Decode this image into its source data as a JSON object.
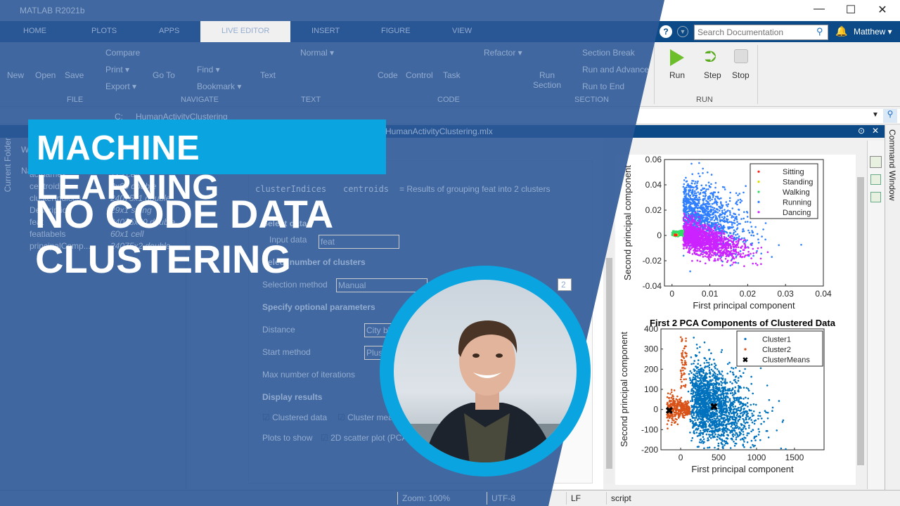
{
  "window": {
    "title": "MATLAB R2021b",
    "minimize": "—",
    "maximize": "☐",
    "close": "✕"
  },
  "tabs": [
    "HOME",
    "PLOTS",
    "APPS",
    "LIVE EDITOR",
    "INSERT",
    "FIGURE",
    "VIEW"
  ],
  "search": {
    "placeholder": "Search Documentation"
  },
  "user": "Matthew ▾",
  "ribbon": {
    "file": {
      "new": "New",
      "open": "Open",
      "save": "Save",
      "compare": "Compare",
      "print": "Print ▾",
      "export": "Export ▾",
      "label": "FILE"
    },
    "navigate": {
      "goto": "Go To",
      "find": "Find ▾",
      "bookmark": "Bookmark ▾",
      "label": "NAVIGATE"
    },
    "text": {
      "text": "Text",
      "normal": "Normal ▾",
      "label": "TEXT"
    },
    "code": {
      "code": "Code",
      "control": "Control",
      "task": "Task",
      "refactor": "Refactor ▾",
      "label": "CODE"
    },
    "section": {
      "run_section": "Run Section",
      "section_break": "Section Break",
      "run_advance": "Run and Advance",
      "run_end": "Run to End",
      "label": "SECTION"
    },
    "run": {
      "run": "Run",
      "step": "Step",
      "stop": "Stop",
      "label": "RUN"
    }
  },
  "address": {
    "drive": "C:",
    "folder": "HumanActivityClustering"
  },
  "editor_tab": "HumanActivityClustering.mlx",
  "side": {
    "current_folder": "Current Folder",
    "workspace": "Workspace",
    "name_header": "Name"
  },
  "workspace": [
    {
      "name": "actnames",
      "value": "1x5 cell"
    },
    {
      "name": "centroids",
      "value": "2x60 double"
    },
    {
      "name": "clusterIndices",
      "value": "24075x1 double"
    },
    {
      "name": "Description",
      "value": "29x1 string"
    },
    {
      "name": "feat",
      "value": "24075x60 double"
    },
    {
      "name": "featlabels",
      "value": "60x1 cell"
    },
    {
      "name": "principalComp...",
      "value": "24075x2 double"
    }
  ],
  "task": {
    "out1": "clusterIndices",
    "out2": "centroids",
    "summary": "= Results of grouping feat into 2 clusters",
    "select_data": "Select data",
    "input_label": "Input data",
    "input_value": "feat",
    "num_clusters": "Select number of clusters",
    "method_label": "Selection method",
    "method_value": "Manual",
    "k": "2",
    "optional": "Specify optional parameters",
    "distance_label": "Distance",
    "distance_value": "City block",
    "start_label": "Start method",
    "start_value": "Plus plus",
    "maxiter_label": "Max number of iterations",
    "display": "Display results",
    "clustered": "Clustered data",
    "means": "Cluster means",
    "plots_label": "Plots to show",
    "plots_value": "2D scatter plot (PCA)"
  },
  "status": {
    "zoom": "Zoom: 100%",
    "encoding": "UTF-8",
    "eol": "LF",
    "type": "script"
  },
  "command_window": "Command Window",
  "overlay": {
    "banner": "MACHINE LEARNING",
    "line1": "NO CODE DATA",
    "line2": "CLUSTERING",
    "accent": "#0aa5e0",
    "tint": "#2c5896"
  },
  "chart_data": [
    {
      "type": "scatter",
      "title": "",
      "xlabel": "First principal component",
      "ylabel": "Second principal component",
      "xlim": [
        -0.002,
        0.04
      ],
      "ylim": [
        -0.04,
        0.06
      ],
      "xticks": [
        "0",
        "0.01",
        "0.02",
        "0.03",
        "0.04"
      ],
      "yticks": [
        "-0.04",
        "-0.02",
        "0",
        "0.02",
        "0.04",
        "0.06"
      ],
      "legend_position": "top-right",
      "series": [
        {
          "name": "Sitting",
          "color": "#ff2020"
        },
        {
          "name": "Standing",
          "color": "#dddd00"
        },
        {
          "name": "Walking",
          "color": "#33dd66"
        },
        {
          "name": "Running",
          "color": "#2f7fff"
        },
        {
          "name": "Dancing",
          "color": "#cc22ff"
        }
      ]
    },
    {
      "type": "scatter",
      "title": "First 2 PCA Components of Clustered Data",
      "xlabel": "First principal component",
      "ylabel": "Second principal component",
      "xlim": [
        -260,
        1890
      ],
      "ylim": [
        -200,
        400
      ],
      "xticks": [
        "0",
        "500",
        "1000",
        "1500"
      ],
      "yticks": [
        "-200",
        "-100",
        "0",
        "100",
        "200",
        "300",
        "400"
      ],
      "legend_position": "top-right",
      "series": [
        {
          "name": "Cluster1",
          "color": "#0072bd"
        },
        {
          "name": "Cluster2",
          "color": "#d95319"
        },
        {
          "name": "ClusterMeans",
          "color": "#000000",
          "points": [
            [
              -150,
              -5
            ],
            [
              440,
              15
            ]
          ]
        }
      ]
    }
  ]
}
